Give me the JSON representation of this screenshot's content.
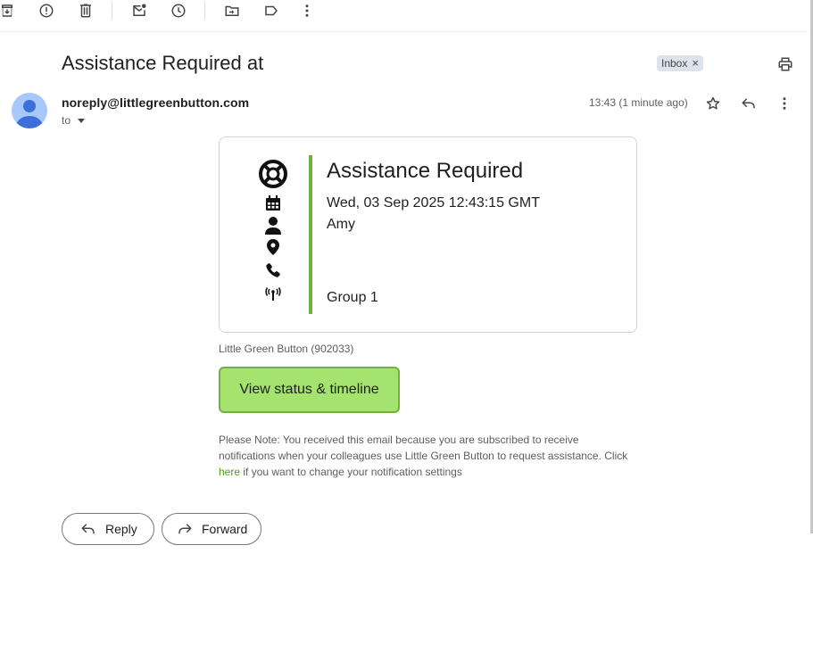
{
  "toolbar": {
    "icons": [
      "archive-icon",
      "report-spam-icon",
      "delete-icon",
      "mark-unread-icon",
      "snooze-icon",
      "move-to-icon",
      "label-icon",
      "more-vert-icon"
    ]
  },
  "email": {
    "subject": "Assistance Required at",
    "label_chip": "Inbox",
    "label_chip_close": "×",
    "sender": "noreply@littlegreenbutton.com",
    "to_label": "to",
    "timestamp": "13:43 (1 minute ago)"
  },
  "card": {
    "title": "Assistance Required",
    "date": "Wed, 03 Sep 2025 12:43:15 GMT",
    "person": "Amy",
    "location": "",
    "phone": "",
    "group": "Group 1",
    "accent_color": "#6fb33e",
    "icons": [
      "lifebuoy-icon",
      "calendar-icon",
      "person-icon",
      "location-pin-icon",
      "phone-icon",
      "antenna-icon"
    ]
  },
  "account": "Little Green Button (902033)",
  "status_button": "View status & timeline",
  "note": {
    "prefix": "Please Note: You received this email because you are subscribed to receive notifications when your colleagues use Little Green Button to request assistance. Click ",
    "link": "here",
    "suffix": " if you want to change your notification settings"
  },
  "actions": {
    "reply": "Reply",
    "forward": "Forward"
  },
  "colors": {
    "button_green": "#a4e36e",
    "link_green": "#4e9a1c",
    "avatar_bg": "#a8c7fa"
  }
}
